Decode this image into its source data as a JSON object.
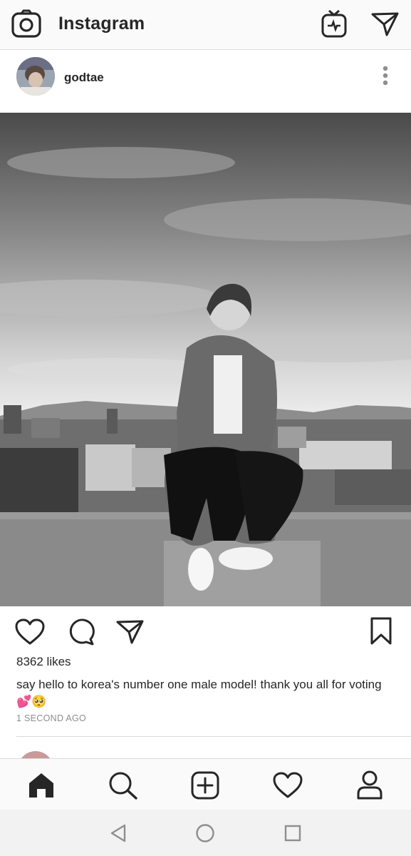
{
  "app": {
    "title": "Instagram",
    "top_icons": [
      "camera-icon",
      "igtv-icon",
      "direct-message-icon"
    ]
  },
  "post": {
    "username": "godtae",
    "more_icon": "more-vertical-icon",
    "likes": "8362 likes",
    "caption": "say hello to korea's number one male model! thank you all for voting",
    "caption_emojis": "💕🥺",
    "timestamp": "1 SECOND AGO",
    "action_icons": [
      "heart-icon",
      "comment-icon",
      "share-icon",
      "bookmark-icon"
    ]
  },
  "bottom_nav": {
    "items": [
      "home-icon",
      "search-icon",
      "add-post-icon",
      "activity-heart-icon",
      "profile-icon"
    ],
    "active": "home-icon"
  },
  "system_nav": [
    "back-icon",
    "home-circle-icon",
    "recents-icon"
  ],
  "colors": {
    "background": "#fafafa",
    "text": "#262626",
    "secondary_text": "#8e8e8e",
    "divider": "#dbdbdb"
  }
}
